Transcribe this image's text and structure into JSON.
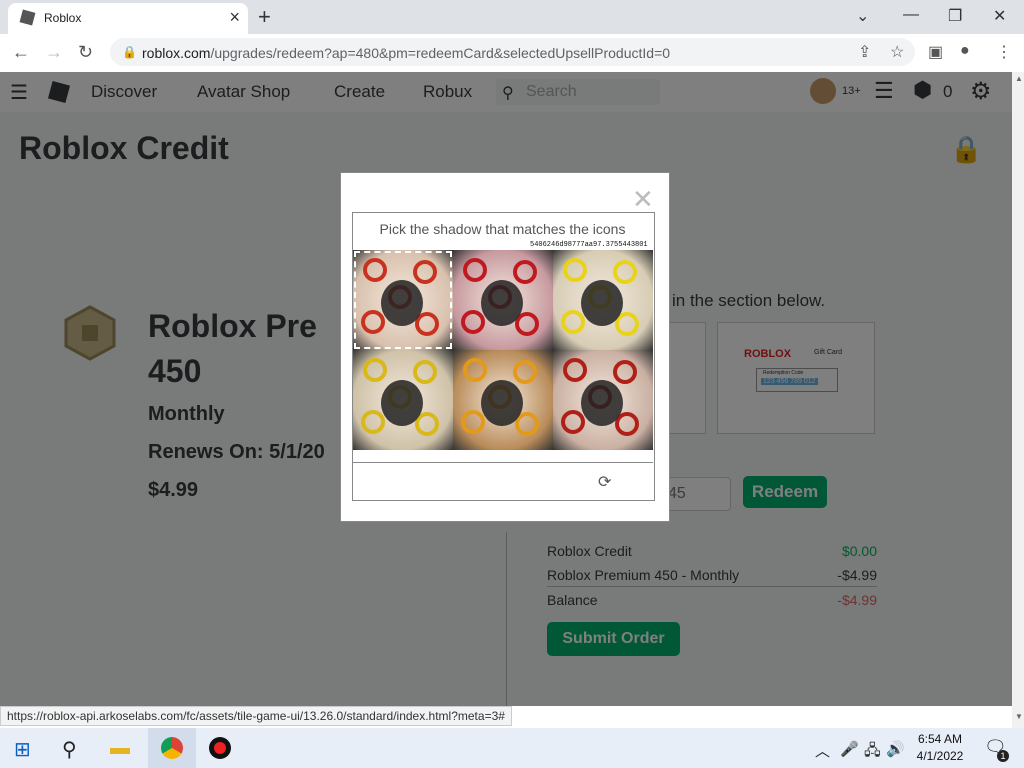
{
  "browser": {
    "tab_title": "Roblox",
    "url_host": "roblox.com",
    "url_path": "/upgrades/redeem?ap=480&pm=redeemCard&selectedUpsellProductId=0"
  },
  "nav": {
    "links": [
      "Discover",
      "Avatar Shop",
      "Create",
      "Robux"
    ],
    "search_placeholder": "Search",
    "age_badge": "13+",
    "robux_count": "0"
  },
  "page": {
    "title": "Roblox Credit",
    "product_name_line1": "Roblox Pre",
    "product_name_line2": "450",
    "billing": "Monthly",
    "renews": "Renews On: 5/1/20",
    "price": "$4.99",
    "section_text": "in the section below.",
    "code_value": "45",
    "redeem_label": "Redeem",
    "card_brand": "ROBLOX",
    "card_sub": "Gift Card",
    "card_redemption_label": "Redemption Code",
    "card_code": "123 456 789 012"
  },
  "summary": {
    "rows": [
      {
        "label": "Roblox Credit",
        "value": "$0.00",
        "color": "#02b757"
      },
      {
        "label": "Roblox Premium 450 - Monthly",
        "value": "-$4.99",
        "color": "#393b3d"
      },
      {
        "label": "Balance",
        "value": "-$4.99",
        "color": "#d86868"
      }
    ],
    "submit_label": "Submit Order"
  },
  "captcha": {
    "instruction": "Pick the shadow that matches the icons",
    "session_id": "5406246d98777aa97.3755443801",
    "tiles": [
      {
        "bg": "#d8c0ad",
        "icon": "#c8321e",
        "selected": true
      },
      {
        "bg": "#c79aa0",
        "icon": "#c01a20",
        "selected": false
      },
      {
        "bg": "#d7cdb5",
        "icon": "#e8d21a",
        "selected": false
      },
      {
        "bg": "#cfc2a8",
        "icon": "#d9b81a",
        "selected": false
      },
      {
        "bg": "#b98c5a",
        "icon": "#e39a1a",
        "selected": false
      },
      {
        "bg": "#c9b0a2",
        "icon": "#b02018",
        "selected": false
      }
    ]
  },
  "status_url": "https://roblox-api.arkoselabs.com/fc/assets/tile-game-ui/13.26.0/standard/index.html?meta=3#",
  "taskbar": {
    "time": "6:54 AM",
    "date": "4/1/2022",
    "notification_count": "1"
  }
}
